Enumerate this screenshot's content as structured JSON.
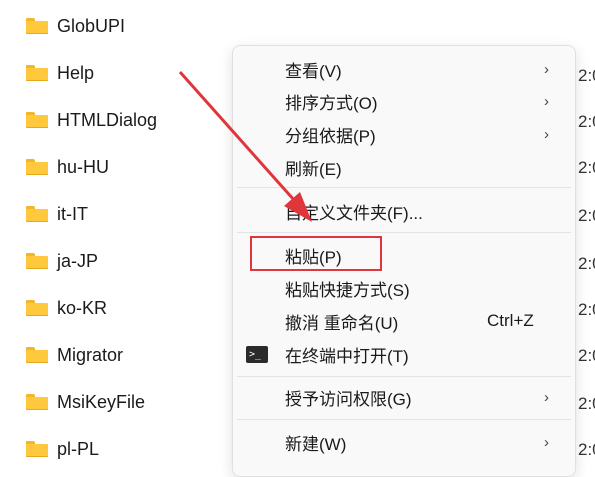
{
  "folders": [
    {
      "name": "GlobUPI"
    },
    {
      "name": "Help"
    },
    {
      "name": "HTMLDialog"
    },
    {
      "name": "hu-HU"
    },
    {
      "name": "it-IT"
    },
    {
      "name": "ja-JP"
    },
    {
      "name": "ko-KR"
    },
    {
      "name": "Migrator"
    },
    {
      "name": "MsiKeyFile"
    },
    {
      "name": "pl-PL"
    }
  ],
  "time_fragment": "2:0",
  "context_menu": {
    "items": [
      {
        "label": "查看(V)",
        "submenu": true
      },
      {
        "label": "排序方式(O)",
        "submenu": true
      },
      {
        "label": "分组依据(P)",
        "submenu": true
      },
      {
        "label": "刷新(E)"
      },
      {
        "label": "自定义文件夹(F)..."
      },
      {
        "label": "粘贴(P)"
      },
      {
        "label": "粘贴快捷方式(S)"
      },
      {
        "label": "撤消 重命名(U)",
        "shortcut": "Ctrl+Z"
      },
      {
        "label": "在终端中打开(T)",
        "icon": "terminal-icon"
      },
      {
        "label": "授予访问权限(G)",
        "submenu": true
      },
      {
        "label": "新建(W)",
        "submenu": true
      }
    ],
    "chevron_glyph": "›"
  },
  "annotation": {
    "color": "#e0363b"
  }
}
